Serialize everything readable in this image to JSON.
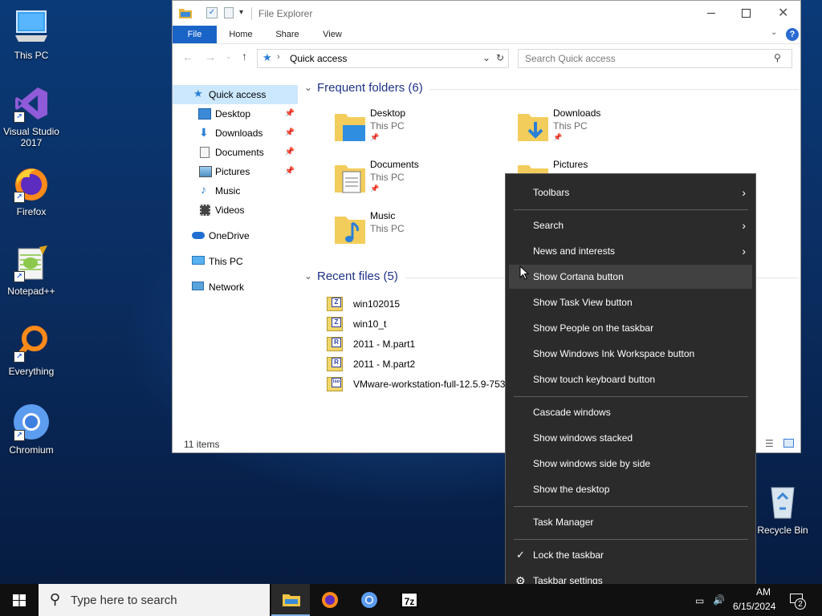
{
  "desktop": {
    "icons": [
      {
        "label": "This PC",
        "icon": "this-pc-icon"
      },
      {
        "label": "Visual Studio\n2017",
        "line1": "Visual Studio",
        "line2": "2017",
        "icon": "visual-studio-icon"
      },
      {
        "label": "Firefox",
        "icon": "firefox-icon"
      },
      {
        "label": "Notepad++",
        "icon": "notepad-plus-plus-icon"
      },
      {
        "label": "Everything",
        "icon": "everything-icon"
      },
      {
        "label": "Chromium",
        "icon": "chromium-icon"
      },
      {
        "label": "Recycle Bin",
        "icon": "recycle-bin-icon"
      }
    ]
  },
  "explorer": {
    "title": "File Explorer",
    "tabs": {
      "file": "File",
      "home": "Home",
      "share": "Share",
      "view": "View"
    },
    "address": {
      "location": "Quick access"
    },
    "search": {
      "placeholder": "Search Quick access"
    },
    "nav": {
      "quick_access": "Quick access",
      "desktop": "Desktop",
      "downloads": "Downloads",
      "documents": "Documents",
      "pictures": "Pictures",
      "music": "Music",
      "videos": "Videos",
      "onedrive": "OneDrive",
      "this_pc": "This PC",
      "network": "Network"
    },
    "frequent": {
      "title": "Frequent folders (6)",
      "items": [
        {
          "name": "Desktop",
          "location": "This PC"
        },
        {
          "name": "Downloads",
          "location": "This PC"
        },
        {
          "name": "Documents",
          "location": "This PC"
        },
        {
          "name": "Pictures",
          "location": ""
        },
        {
          "name": "Music",
          "location": "This PC"
        }
      ]
    },
    "recent": {
      "title": "Recent files (5)",
      "items": [
        {
          "name": "win102015",
          "badge": "Z"
        },
        {
          "name": "win10_t",
          "badge": "Z"
        },
        {
          "name": "2011 - M.part1",
          "badge": "R"
        },
        {
          "name": "2011 - M.part2",
          "badge": "R"
        },
        {
          "name": "VMware-workstation-full-12.5.9-753",
          "badge": "iso"
        }
      ]
    },
    "status": {
      "items": "11 items"
    }
  },
  "context_menu": {
    "toolbars": "Toolbars",
    "search": "Search",
    "news": "News and interests",
    "cortana": "Show Cortana button",
    "task_view": "Show Task View button",
    "people": "Show People on the taskbar",
    "ink": "Show Windows Ink Workspace button",
    "touch_keyboard": "Show touch keyboard button",
    "cascade": "Cascade windows",
    "stacked": "Show windows stacked",
    "side_by_side": "Show windows side by side",
    "show_desktop": "Show the desktop",
    "task_manager": "Task Manager",
    "lock": "Lock the taskbar",
    "settings": "Taskbar settings"
  },
  "taskbar": {
    "search_placeholder": "Type here to search",
    "clock_time": "AM",
    "clock_date": "6/15/2024",
    "notification_count": "2",
    "seven_zip_label": "7z"
  },
  "colors": {
    "accent": "#0a64c8",
    "menu_bg": "#2b2b2b",
    "menu_highlight": "#414141",
    "section_title": "#1e3287",
    "taskbar": "#101010"
  }
}
